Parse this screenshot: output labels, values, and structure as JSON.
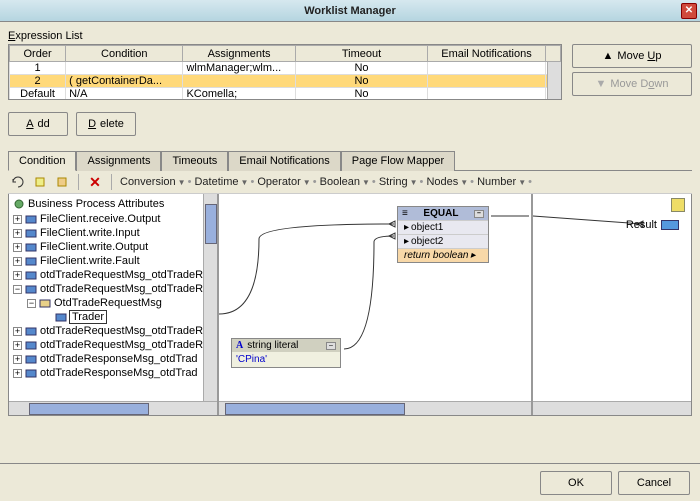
{
  "title": "Worklist Manager",
  "section_label": "Expression List",
  "table": {
    "headers": [
      "Order",
      "Condition",
      "Assignments",
      "Timeout",
      "Email Notifications",
      ""
    ],
    "rows": [
      {
        "order": "1",
        "condition": "",
        "assignments": "wlmManager;wlm...",
        "timeout": "No",
        "email": "",
        "selected": false
      },
      {
        "order": "2",
        "condition": "( getContainerDa...",
        "assignments": "",
        "timeout": "No",
        "email": "",
        "selected": true
      },
      {
        "order": "Default",
        "condition": "N/A",
        "assignments": "KComella;",
        "timeout": "No",
        "email": "",
        "selected": false
      }
    ]
  },
  "buttons": {
    "move_up": "Move Up",
    "move_down": "Move Down",
    "add": "Add",
    "delete": "Delete",
    "ok": "OK",
    "cancel": "Cancel"
  },
  "tabs": [
    "Condition",
    "Assignments",
    "Timeouts",
    "Email Notifications",
    "Page Flow Mapper"
  ],
  "active_tab": 0,
  "toolbar_menus": [
    "Conversion",
    "Datetime",
    "Operator",
    "Boolean",
    "String",
    "Nodes",
    "Number"
  ],
  "tree": {
    "root": "Business Process Attributes",
    "items": [
      {
        "label": "FileClient.receive.Output",
        "level": 1,
        "expandable": true
      },
      {
        "label": "FileClient.write.Input",
        "level": 1,
        "expandable": true
      },
      {
        "label": "FileClient.write.Output",
        "level": 1,
        "expandable": true
      },
      {
        "label": "FileClient.write.Fault",
        "level": 1,
        "expandable": true
      },
      {
        "label": "otdTradeRequestMsg_otdTradeR",
        "level": 1,
        "expandable": true
      },
      {
        "label": "otdTradeRequestMsg_otdTradeR",
        "level": 1,
        "expandable": true,
        "open": true
      },
      {
        "label": "OtdTradeRequestMsg",
        "level": 2,
        "expandable": true,
        "open": true,
        "color": "#e8d088"
      },
      {
        "label": "Trader",
        "level": 3,
        "expandable": false,
        "selected": true
      },
      {
        "label": "otdTradeRequestMsg_otdTradeR",
        "level": 1,
        "expandable": true
      },
      {
        "label": "otdTradeRequestMsg_otdTradeR",
        "level": 1,
        "expandable": true
      },
      {
        "label": "otdTradeResponseMsg_otdTrad",
        "level": 1,
        "expandable": true
      },
      {
        "label": "otdTradeResponseMsg_otdTrad",
        "level": 1,
        "expandable": true
      }
    ]
  },
  "canvas": {
    "equal_node": {
      "title": "EQUAL",
      "rows": [
        "object1",
        "object2"
      ],
      "return": "return boolean"
    },
    "literal": {
      "title": "string literal",
      "value": "'CPina'"
    }
  },
  "result_label": "Result"
}
